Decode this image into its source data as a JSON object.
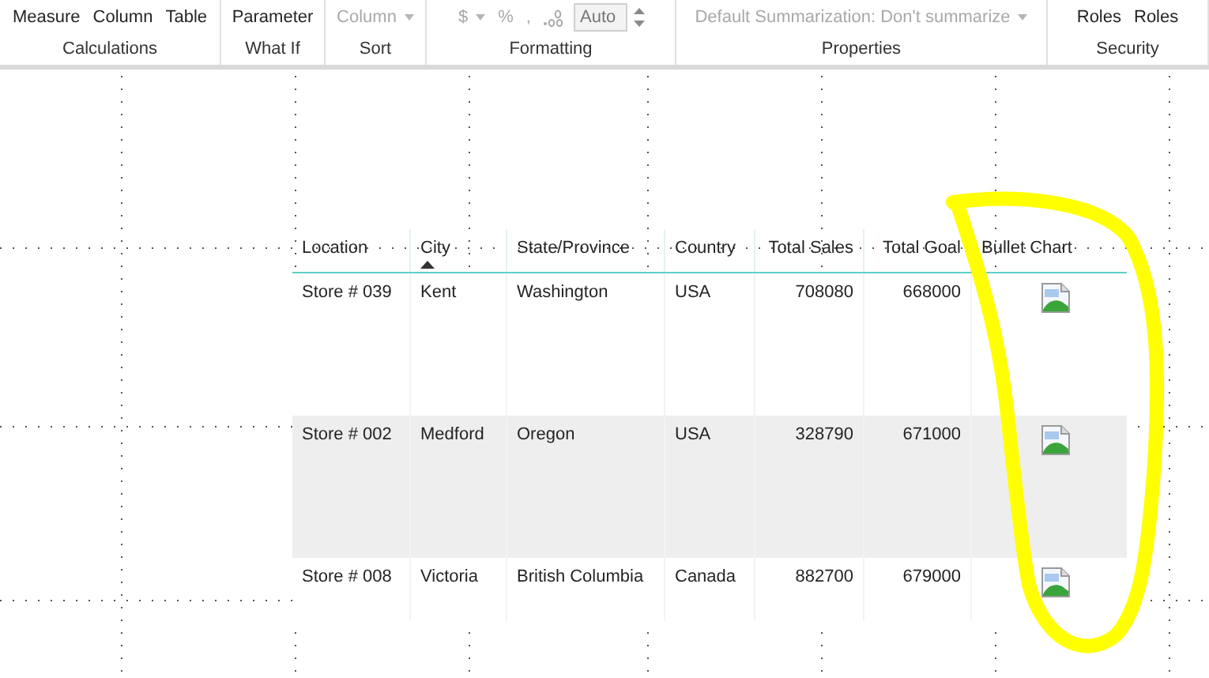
{
  "ribbon": {
    "groups": [
      {
        "label": "Calculations",
        "items": [
          {
            "kind": "button",
            "label": "Measure",
            "disabled": false
          },
          {
            "kind": "button",
            "label": "Column",
            "disabled": false
          },
          {
            "kind": "button",
            "label": "Table",
            "disabled": false
          }
        ]
      },
      {
        "label": "What If",
        "items": [
          {
            "kind": "button",
            "label": "Parameter",
            "disabled": false
          }
        ]
      },
      {
        "label": "Sort",
        "items": [
          {
            "kind": "dropdown",
            "label": "Column",
            "disabled": true
          }
        ]
      },
      {
        "label": "Formatting",
        "items": [
          {
            "kind": "dropdown",
            "label": "$",
            "disabled": true
          },
          {
            "kind": "button",
            "label": "%",
            "disabled": true
          },
          {
            "kind": "button",
            "label": ",",
            "disabled": true
          },
          {
            "kind": "decimal",
            "disabled": true
          },
          {
            "kind": "spinner",
            "value": "Auto",
            "disabled": true
          }
        ]
      },
      {
        "label": "Properties",
        "items": [
          {
            "kind": "dropdown",
            "label": "Default Summarization: Don't summarize",
            "disabled": true
          }
        ]
      },
      {
        "label": "Security",
        "items": [
          {
            "kind": "button",
            "label": "Roles",
            "disabled": false
          },
          {
            "kind": "button",
            "label": "Roles",
            "disabled": false
          }
        ]
      }
    ]
  },
  "table": {
    "columns": [
      {
        "label": "Location",
        "kind": "text",
        "sorted": false
      },
      {
        "label": "City",
        "kind": "text",
        "sorted": true
      },
      {
        "label": "State/Province",
        "kind": "text",
        "sorted": false
      },
      {
        "label": "Country",
        "kind": "text",
        "sorted": false
      },
      {
        "label": "Total Sales",
        "kind": "number",
        "sorted": false
      },
      {
        "label": "Total Goal",
        "kind": "number",
        "sorted": false
      },
      {
        "label": "Bullet Chart",
        "kind": "image",
        "sorted": false
      }
    ],
    "rows": [
      {
        "highlighted": false,
        "cells": [
          "Store # 039",
          "Kent",
          "Washington",
          "USA",
          "708080",
          "668000",
          ""
        ]
      },
      {
        "highlighted": true,
        "cells": [
          "Store # 002",
          "Medford",
          "Oregon",
          "USA",
          "328790",
          "671000",
          ""
        ]
      },
      {
        "highlighted": false,
        "cells": [
          "Store # 008",
          "Victoria",
          "British Columbia",
          "Canada",
          "882700",
          "679000",
          ""
        ]
      }
    ]
  }
}
